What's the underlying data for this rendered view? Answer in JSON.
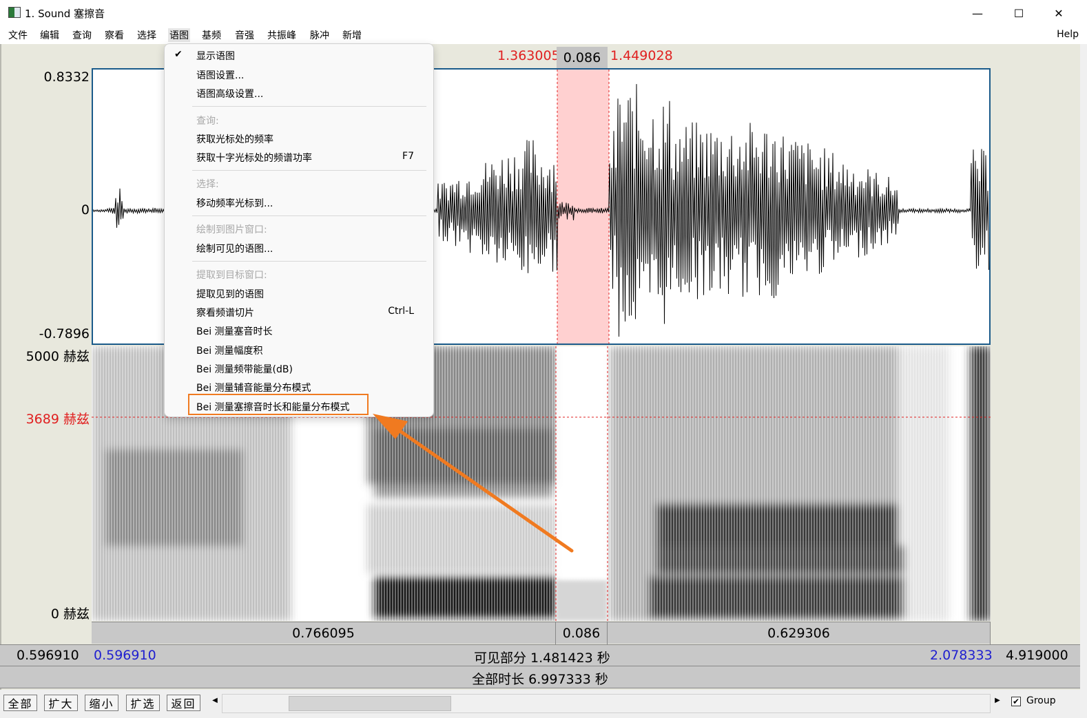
{
  "window": {
    "title": "1. Sound 塞擦音",
    "minimize": "—",
    "maximize": "☐",
    "close": "✕"
  },
  "menubar": {
    "items": [
      "文件",
      "编辑",
      "查询",
      "察看",
      "选择",
      "语图",
      "基频",
      "音强",
      "共振峰",
      "脉冲",
      "新增"
    ],
    "help": "Help"
  },
  "dropdown": {
    "items": [
      {
        "label": "显示语图",
        "checked": true
      },
      {
        "label": "语图设置..."
      },
      {
        "label": "语图高级设置..."
      },
      {
        "label": "查询:",
        "disabled": true
      },
      {
        "label": "获取光标处的频率"
      },
      {
        "label": "获取十字光标处的频谱功率",
        "shortcut": "F7"
      },
      {
        "label": "选择:",
        "disabled": true
      },
      {
        "label": "移动频率光标到..."
      },
      {
        "label": "绘制到图片窗口:",
        "disabled": true
      },
      {
        "label": "绘制可见的语图..."
      },
      {
        "label": "提取到目标窗口:",
        "disabled": true
      },
      {
        "label": "提取见到的语图"
      },
      {
        "label": "察看频谱切片",
        "shortcut": "Ctrl-L"
      },
      {
        "label": "Bei 测量塞音时长"
      },
      {
        "label": "Bei 测量幅度积"
      },
      {
        "label": "Bei 测量频带能量(dB)"
      },
      {
        "label": "Bei 测量辅音能量分布模式"
      },
      {
        "label": "Bei 测量塞擦音时长和能量分布模式"
      }
    ]
  },
  "waveform": {
    "ymax": "0.8332",
    "yzero": "0",
    "ymin": "-0.7896"
  },
  "spectrogram": {
    "fmax": "5000 赫兹",
    "cursor_freq": "3689 赫兹",
    "fmin": "0 赫兹"
  },
  "selection": {
    "start": "1.363005",
    "duration": "0.086",
    "end": "1.449028"
  },
  "bottom_bar": {
    "left": "0.766095",
    "mid": "0.086",
    "right": "0.629306"
  },
  "visible": {
    "outer_left": "0.596910",
    "start": "0.596910",
    "label": "可见部分 1.481423 秒",
    "end": "2.078333",
    "outer_right": "4.919000"
  },
  "total": "全部时长 6.997333 秒",
  "toolbar": {
    "all": "全部",
    "zoom_in": "扩大",
    "zoom_out": "缩小",
    "zoom_sel": "扩选",
    "back": "返回",
    "scroll_left": "◀",
    "scroll_right": "▶",
    "group_check": "✔",
    "group": "Group"
  },
  "colors": {
    "selection_fill": "#ffd0d0",
    "cursor_red": "#e02020",
    "visible_blue": "#2020d0",
    "highlight_orange": "#f07a20"
  }
}
